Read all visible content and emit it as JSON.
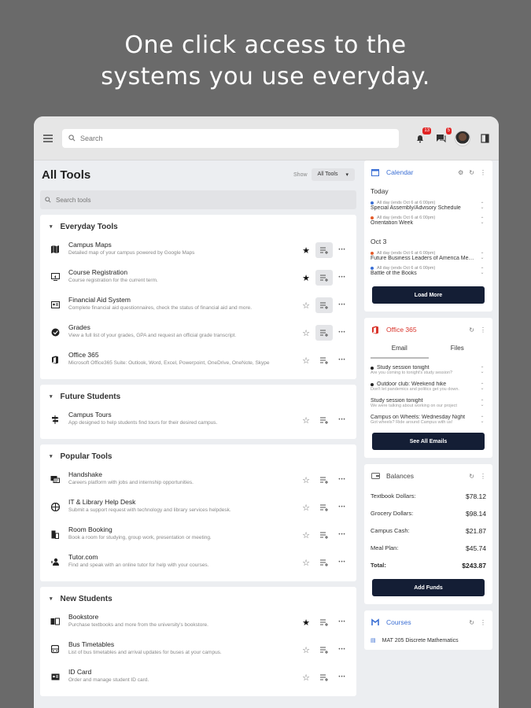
{
  "headline": {
    "line1": "One click access to the",
    "line2": "systems you use everyday."
  },
  "topbar": {
    "search_placeholder": "Search",
    "notifications_count": "13",
    "messages_count": "5"
  },
  "tools": {
    "title": "All Tools",
    "show_label": "Show",
    "show_value": "All Tools",
    "search_placeholder": "Search tools",
    "sections": [
      {
        "title": "Everyday Tools",
        "items": [
          {
            "name": "Campus Maps",
            "desc": "Detailed map of your campus powered by Google Maps",
            "icon": "map-icon",
            "starred": true,
            "added": true
          },
          {
            "name": "Course Registration",
            "desc": "Course registration for the current term.",
            "icon": "monitor-icon",
            "starred": true,
            "added": true
          },
          {
            "name": "Financial Aid System",
            "desc": "Complete financial aid questionnaires, check the status of financial aid and more.",
            "icon": "id-card-icon",
            "starred": false,
            "added": true
          },
          {
            "name": "Grades",
            "desc": "View a full list of your grades, GPA and request an official grade transcript.",
            "icon": "check-circle-icon",
            "starred": false,
            "added": true
          },
          {
            "name": "Office 365",
            "desc": "Microsoft Office365 Suite: Outlook, Word, Excel, Powerpoint, OneDrive, OneNote, Skype",
            "icon": "office-icon",
            "starred": false,
            "added": false
          }
        ]
      },
      {
        "title": "Future Students",
        "items": [
          {
            "name": "Campus Tours",
            "desc": "App designed to help students find tours for their desired campus.",
            "icon": "signpost-icon",
            "starred": false,
            "added": false
          }
        ]
      },
      {
        "title": "Popular Tools",
        "items": [
          {
            "name": "Handshake",
            "desc": "Careers platform with jobs and internship opportunities.",
            "icon": "handshake-icon",
            "starred": false,
            "added": false
          },
          {
            "name": "IT & Library Help Desk",
            "desc": "Submit a support request with technology and library services helpdesk.",
            "icon": "globe-icon",
            "starred": false,
            "added": false
          },
          {
            "name": "Room Booking",
            "desc": "Book a room for studying, group work, presentation or meeting.",
            "icon": "building-icon",
            "starred": false,
            "added": false
          },
          {
            "name": "Tutor.com",
            "desc": "Find and speak with an online tutor for help with your courses.",
            "icon": "tutor-icon",
            "starred": false,
            "added": false
          }
        ]
      },
      {
        "title": "New Students",
        "items": [
          {
            "name": "Bookstore",
            "desc": "Purchase textbooks and more from the university's bookstore.",
            "icon": "book-icon",
            "starred": true,
            "added": false
          },
          {
            "name": "Bus Timetables",
            "desc": "List of bus timetables and arrival updates for buses at your campus.",
            "icon": "bus-icon",
            "starred": false,
            "added": false
          },
          {
            "name": "ID Card",
            "desc": "Order and manage student ID card.",
            "icon": "badge-icon",
            "starred": false,
            "added": false
          }
        ]
      }
    ]
  },
  "calendar": {
    "title": "Calendar",
    "days": [
      {
        "label": "Today",
        "events": [
          {
            "meta": "All day (ends Oct 6 at 6:00pm)",
            "title": "Special Assembly/Advisory Schedule",
            "color": "#3b6fd4"
          },
          {
            "meta": "All day (ends Oct 6 at 6:00pm)",
            "title": "Orientation Week",
            "color": "#e35b2a"
          }
        ]
      },
      {
        "label": "Oct 3",
        "events": [
          {
            "meta": "All day (ends Oct 6 at 6:00pm)",
            "title": "Future Business Leaders of America Meeting",
            "color": "#e35b2a"
          },
          {
            "meta": "All day (ends Oct 6 at 6:00pm)",
            "title": "Battle of the Books",
            "color": "#3b6fd4"
          }
        ]
      }
    ],
    "button": "Load More"
  },
  "office": {
    "title": "Office 365",
    "tabs": [
      "Email",
      "Files"
    ],
    "emails": [
      {
        "subject": "Study session tonight",
        "preview": "Are you coming to tonight's study session?",
        "unread": true
      },
      {
        "subject": "Outdoor club: Weekend hike",
        "preview": "Don't let pandemics and politics get you down.",
        "unread": true
      },
      {
        "subject": "Study session tonight",
        "preview": "We were talking about working on our project",
        "unread": false
      },
      {
        "subject": "Campus on Wheels: Wednesday Night",
        "preview": "Got wheels? Ride around Campus with us!",
        "unread": false
      }
    ],
    "button": "See All Emails"
  },
  "balances": {
    "title": "Balances",
    "rows": [
      {
        "label": "Textbook Dollars:",
        "value": "$78.12"
      },
      {
        "label": "Grocery Dollars:",
        "value": "$98.14"
      },
      {
        "label": "Campus Cash:",
        "value": "$21.87"
      },
      {
        "label": "Meal Plan:",
        "value": "$45.74"
      }
    ],
    "total_label": "Total:",
    "total_value": "$243.87",
    "button": "Add Funds"
  },
  "courses": {
    "title": "Courses",
    "first": "MAT 205 Discrete Mathematics"
  },
  "colors": {
    "navy": "#141e35",
    "accent_blue": "#3b6fd4",
    "office_red": "#d9342b"
  }
}
